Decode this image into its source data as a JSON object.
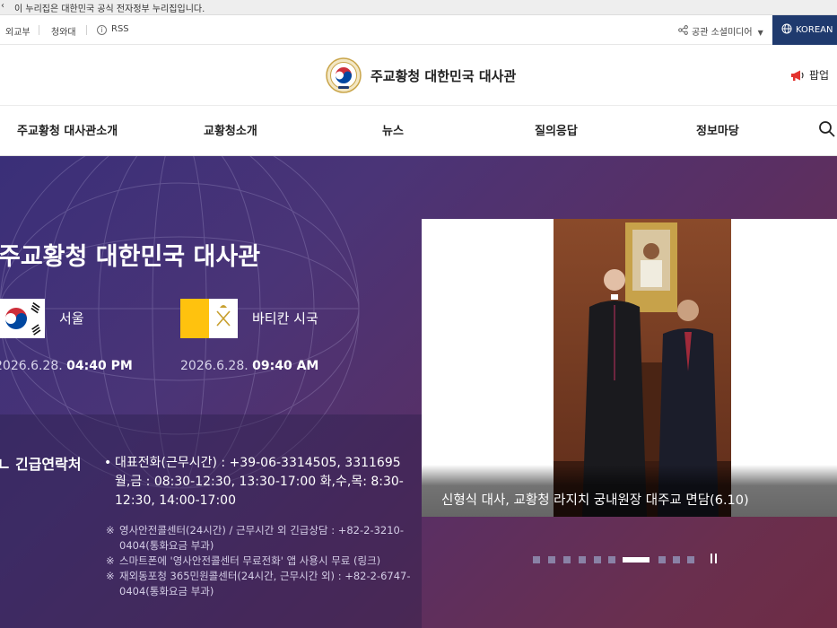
{
  "gov_banner": {
    "text": "이 누리집은 대한민국 공식 전자정부 누리집입니다."
  },
  "utility": {
    "links": [
      "외교부",
      "청와대",
      "RSS"
    ],
    "social_label": "공관 소셜미디어",
    "language": "KOREAN"
  },
  "header": {
    "site_title": "주교황청 대한민국 대사관",
    "popup_label": "팝업"
  },
  "nav": {
    "items": [
      "주교황청 대사관소개",
      "교황청소개",
      "뉴스",
      "질의응답",
      "정보마당"
    ]
  },
  "hero": {
    "title": "주교황청 대한민국 대사관",
    "clocks": [
      {
        "city": "서울",
        "date": "2026.6.28.",
        "time": "04:40 PM"
      },
      {
        "city": "바티칸 시국",
        "date": "2026.6.28.",
        "time": "09:40 AM"
      }
    ],
    "contact": {
      "heading": "긴급연락처",
      "main_bullet": "•",
      "main": "대표전화(근무시간) : +39-06-3314505, 3311695 월,금 : 08:30-12:30, 13:30-17:00 화,수,목: 8:30-12:30, 14:00-17:00",
      "note_mark": "※",
      "notes": [
        "영사안전콜센터(24시간) / 근무시간 외 긴급상담 : +82-2-3210-0404(통화요금 부과)",
        "스마트폰에 '영사안전콜센터 무료전화' 앱 사용시 무료 (링크)",
        "재외동포청 365민원콜센터(24시간, 근무시간 외) : +82-2-6747-0404(통화요금 부과)"
      ]
    }
  },
  "slider": {
    "caption": "신형식 대사, 교황청 라지치 궁내원장 대주교 면담(6.10)",
    "total_slides": 11,
    "active_index": 6
  },
  "colors": {
    "lang_button": "#1f3a6e",
    "hero_start": "#3a2f78",
    "hero_end": "#6e2c45"
  }
}
